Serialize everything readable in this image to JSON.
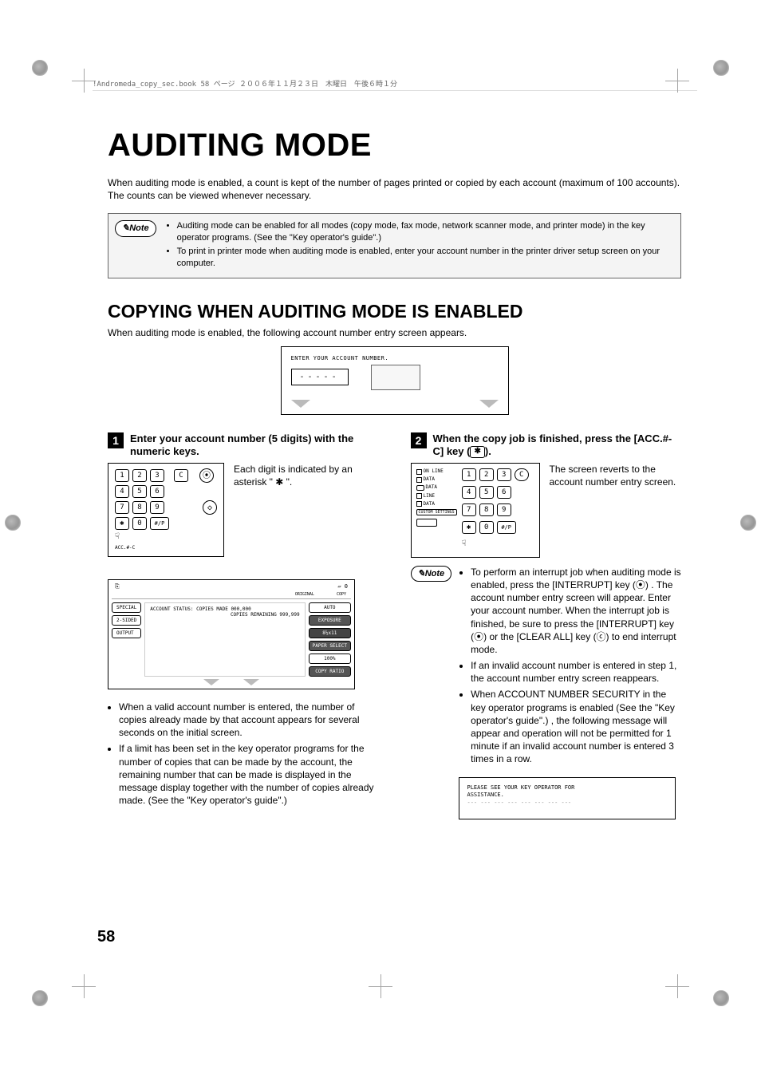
{
  "header_line": "!Andromeda_copy_sec.book  58 ページ  ２００６年１１月２３日　木曜日　午後６時１分",
  "title": "AUDITING MODE",
  "intro": "When auditing mode is enabled, a count is kept of the number of pages printed or copied by each account (maximum of 100 accounts). The counts can be viewed whenever necessary.",
  "note_label": "Note",
  "note1_items": [
    "Auditing mode can be enabled for all modes (copy mode, fax mode, network scanner mode, and printer mode) in the key operator programs. (See the \"Key operator's guide\".)",
    "To print in printer mode when auditing mode is enabled, enter your account number in the printer driver setup screen on your computer."
  ],
  "subtitle": "COPYING WHEN AUDITING MODE IS ENABLED",
  "subintro": "When auditing mode is enabled, the following account number entry screen appears.",
  "account_screen_title": "ENTER YOUR ACCOUNT NUMBER.",
  "account_screen_mask": "-----",
  "step1_num": "1",
  "step1_title": "Enter your account number (5 digits) with the numeric keys.",
  "step1_text": "Each digit is indicated by an asterisk \" ✱ \".",
  "step1_acc_label": "ACC.#-C",
  "keypad_keys_row1": [
    "1",
    "2",
    "3"
  ],
  "keypad_keys_row2": [
    "4",
    "5",
    "6"
  ],
  "keypad_keys_row3": [
    "7",
    "8",
    "9"
  ],
  "keypad_keys_row4": [
    "✱",
    "0",
    "#/P"
  ],
  "keypad_clear": "C",
  "status_panel": {
    "top_left_icon": "⎘",
    "top_right_icons": "▱  0",
    "strip_left": "ORIGINAL",
    "strip_right": "COPY",
    "left_buttons": [
      "SPECIAL",
      "2-SIDED",
      "OUTPUT"
    ],
    "mid_line1": "ACCOUNT STATUS:  COPIES MADE 000,000",
    "mid_line2": "COPIES REMAINING 999,999",
    "right_buttons": [
      "AUTO",
      "EXPOSURE",
      "8½x11",
      "PAPER SELECT",
      "100%",
      "COPY RATIO"
    ]
  },
  "step1_bullets": [
    "When a valid account number is entered, the number of copies already made by that account appears for several seconds on the initial screen.",
    "If a limit has been set in the key operator programs for the number of copies that can be made by the account, the remaining number that can be made is displayed in the message display together with the number of copies already made. (See the \"Key operator's guide\".)"
  ],
  "step2_num": "2",
  "step2_title_a": "When the copy job is finished, press the [ACC.#-C] key (",
  "step2_title_b": ").",
  "step2_key_sym": "✱",
  "step2_text": "The screen reverts to the account number entry screen.",
  "panel2_lines": [
    "ON LINE",
    "DATA",
    "DATA",
    "LINE",
    "DATA"
  ],
  "panel2_btn": "CUSTOM SETTINGS",
  "note2_items": [
    "To perform an interrupt job when auditing mode is enabled, press the [INTERRUPT] key (⦿) . The account number entry screen will appear. Enter your account number. When the interrupt job is finished, be sure to press the [INTERRUPT] key (⦿)  or the [CLEAR ALL] key (ⓒ)  to end interrupt mode.",
    "If an invalid account number is entered in step 1, the account number entry screen reappears.",
    "When ACCOUNT NUMBER SECURITY in the key operator programs is enabled (See the \"Key operator's guide\".) , the following message will appear and operation will not be permitted for 1 minute if an invalid account number is entered 3 times in a row."
  ],
  "warn_line1": "PLEASE SEE YOUR KEY OPERATOR FOR",
  "warn_line2": "ASSISTANCE.",
  "warn_dash": "--- --- --- --- --- --- --- ---",
  "page_number": "58"
}
